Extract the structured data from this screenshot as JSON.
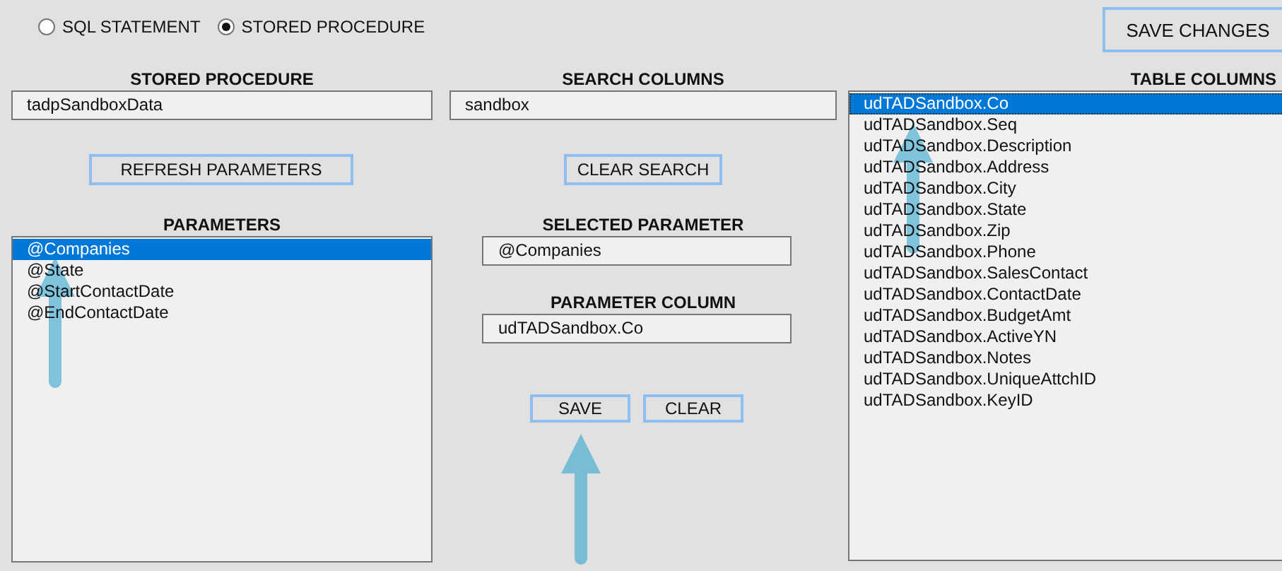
{
  "mode_options": [
    {
      "label": "SQL STATEMENT",
      "selected": false
    },
    {
      "label": "STORED PROCEDURE",
      "selected": true
    }
  ],
  "save_changes_button": "SAVE CHANGES",
  "stored_procedure": {
    "label": "STORED PROCEDURE",
    "value": "tadpSandboxData"
  },
  "refresh_button": "REFRESH PARAMETERS",
  "parameters": {
    "label": "PARAMETERS",
    "items": [
      {
        "text": "@Companies",
        "selected": true
      },
      {
        "text": "@State",
        "selected": false
      },
      {
        "text": "@StartContactDate",
        "selected": false
      },
      {
        "text": "@EndContactDate",
        "selected": false
      }
    ]
  },
  "search_columns": {
    "label": "SEARCH COLUMNS",
    "value": "sandbox"
  },
  "clear_search_button": "CLEAR SEARCH",
  "selected_parameter": {
    "label": "SELECTED PARAMETER",
    "value": "@Companies"
  },
  "parameter_column": {
    "label": "PARAMETER COLUMN",
    "value": "udTADSandbox.Co"
  },
  "buttons": [
    "SAVE",
    "CLEAR"
  ],
  "table_columns": {
    "label": "TABLE COLUMNS",
    "items": [
      {
        "text": "udTADSandbox.Co",
        "selected": true
      },
      {
        "text": "udTADSandbox.Seq",
        "selected": false
      },
      {
        "text": "udTADSandbox.Description",
        "selected": false
      },
      {
        "text": "udTADSandbox.Address",
        "selected": false
      },
      {
        "text": "udTADSandbox.City",
        "selected": false
      },
      {
        "text": "udTADSandbox.State",
        "selected": false
      },
      {
        "text": "udTADSandbox.Zip",
        "selected": false
      },
      {
        "text": "udTADSandbox.Phone",
        "selected": false
      },
      {
        "text": "udTADSandbox.SalesContact",
        "selected": false
      },
      {
        "text": "udTADSandbox.ContactDate",
        "selected": false
      },
      {
        "text": "udTADSandbox.BudgetAmt",
        "selected": false
      },
      {
        "text": "udTADSandbox.ActiveYN",
        "selected": false
      },
      {
        "text": "udTADSandbox.Notes",
        "selected": false
      },
      {
        "text": "udTADSandbox.UniqueAttchID",
        "selected": false
      },
      {
        "text": "udTADSandbox.KeyID",
        "selected": false
      }
    ]
  }
}
